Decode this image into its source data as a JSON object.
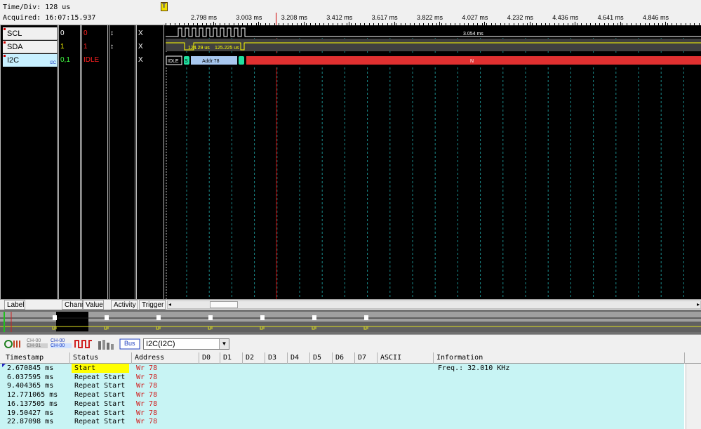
{
  "header": {
    "time_div": "Time/Div: 128 us",
    "acquired": "Acquired: 16:07:15.937",
    "trigger_marker": "T",
    "ruler_ticks": [
      "2.798 ms",
      "3.003 ms",
      "3.208 ms",
      "3.412 ms",
      "3.617 ms",
      "3.822 ms",
      "4.027 ms",
      "4.232 ms",
      "4.436 ms",
      "4.641 ms",
      "4.846 ms"
    ]
  },
  "channels": [
    {
      "label": "SCL",
      "chann": "0",
      "value": "0",
      "activity": "↕",
      "trigger": "X"
    },
    {
      "label": "SDA",
      "chann": "1",
      "value": "1",
      "activity": "↕",
      "trigger": "X"
    },
    {
      "label": "I2C",
      "chann": "0,1",
      "value": "IDLE",
      "activity": "",
      "trigger": "X",
      "badge": "I2C"
    }
  ],
  "waveform": {
    "scl_duration": "3.054 ms",
    "sda_measure_1": "124.29 us",
    "sda_measure_2": "125.225 us",
    "i2c_idle": "IDLE",
    "i2c_start": "S",
    "i2c_addr": "Addr:78",
    "i2c_nack": "N"
  },
  "column_headers": {
    "label": "Label",
    "chann": "Chann",
    "value": "Value",
    "activity": "Activity",
    "trigger": "Trigger"
  },
  "toolbar": {
    "ch00_a": "CH-00",
    "ch01_a": "CH-01",
    "ch00_b": "CH-00",
    "ch01_b": "CH-00",
    "bus_label": "Bus",
    "protocol": "I2C(I2C)"
  },
  "table": {
    "columns": [
      "Timestamp",
      "Status",
      "Address",
      "D0",
      "D1",
      "D2",
      "D3",
      "D4",
      "D5",
      "D6",
      "D7",
      "ASCII",
      "Information"
    ],
    "rows": [
      {
        "timestamp": "2.670845 ms",
        "status": "Start",
        "address": "Wr 78",
        "info": "Freq.: 32.010 KHz"
      },
      {
        "timestamp": "6.037595 ms",
        "status": "Repeat Start",
        "address": "Wr 78",
        "info": ""
      },
      {
        "timestamp": "9.404365 ms",
        "status": "Repeat Start",
        "address": "Wr 78",
        "info": ""
      },
      {
        "timestamp": "12.771065 ms",
        "status": "Repeat Start",
        "address": "Wr 78",
        "info": ""
      },
      {
        "timestamp": "16.137505 ms",
        "status": "Repeat Start",
        "address": "Wr 78",
        "info": ""
      },
      {
        "timestamp": "19.50427 ms",
        "status": "Repeat Start",
        "address": "Wr 78",
        "info": ""
      },
      {
        "timestamp": "22.87098 ms",
        "status": "Repeat Start",
        "address": "Wr 78",
        "info": ""
      }
    ]
  },
  "colors": {
    "accent_red": "#e03030",
    "highlight_yellow": "#ffff00",
    "table_bg": "#c8f4f4",
    "i2c_addr_bg": "#a8c8f0"
  }
}
